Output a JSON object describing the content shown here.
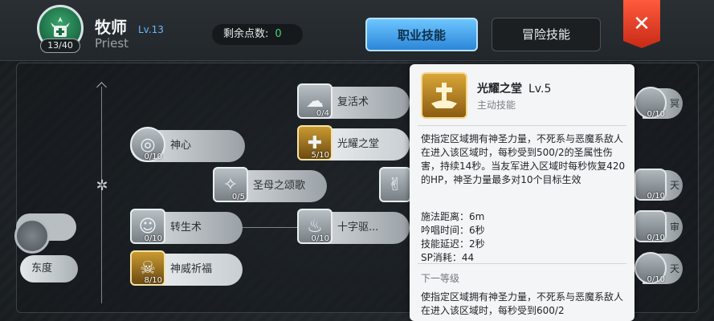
{
  "header": {
    "class_name": "牧师",
    "class_level": "Lv.13",
    "class_name_en": "Priest",
    "job_level": "13/40",
    "points_label": "剩余点数:",
    "points_value": "0",
    "tabs": [
      "职业技能",
      "冒险技能"
    ],
    "close_label": "✕"
  },
  "skills": [
    {
      "name": "复活术",
      "level": "0/4"
    },
    {
      "name": "光耀之堂",
      "level": "5/10"
    },
    {
      "name": "神心",
      "level": "0/10"
    },
    {
      "name": "圣母之颂歌",
      "level": "0/5"
    },
    {
      "name": "转生术",
      "level": "0/10"
    },
    {
      "name": "十字驱...",
      "level": "0/10"
    },
    {
      "name": "神威祈福",
      "level": "8/10"
    }
  ],
  "left": {
    "partial_label": "东度"
  },
  "right": [
    {
      "label": "冥",
      "level": "0/10"
    },
    {
      "label": "天",
      "level": "0/10"
    },
    {
      "label": "审",
      "level": "0/10"
    },
    {
      "label": "天",
      "level": "0/10"
    }
  ],
  "tooltip": {
    "name": "光耀之堂",
    "level": "Lv.5",
    "type": "主动技能",
    "description": "使指定区域拥有神圣力量，不死系与恶魔系敌人在进入该区域时，每秒受到500/2的圣属性伤害，持续14秒。当友军进入区域时每秒恢复420的HP，神圣力量最多对10个目标生效",
    "stats": [
      "施法距离：6m",
      "吟唱时间：6秒",
      "技能延迟：2秒",
      "SP消耗：44"
    ],
    "next_level_label": "下一等级",
    "next_description": "使指定区域拥有神圣力量，不死系与恶魔系敌人在进入该区域时，每秒受到600/2"
  },
  "colors": {
    "accent": "#2b86d8",
    "close": "#e03a22",
    "points": "#49d37a"
  }
}
